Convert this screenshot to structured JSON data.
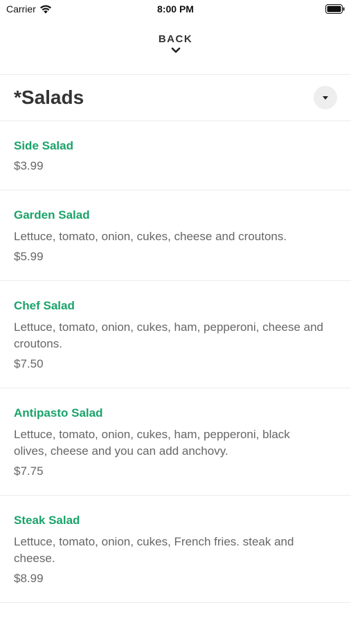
{
  "status_bar": {
    "carrier": "Carrier",
    "time": "8:00 PM"
  },
  "nav": {
    "back_label": "BACK"
  },
  "category": {
    "title": "*Salads"
  },
  "items": [
    {
      "name": "Side Salad",
      "description": "",
      "price": "$3.99"
    },
    {
      "name": "Garden Salad",
      "description": "Lettuce, tomato, onion, cukes, cheese and croutons.",
      "price": "$5.99"
    },
    {
      "name": "Chef Salad",
      "description": "Lettuce, tomato, onion, cukes, ham, pepperoni, cheese and croutons.",
      "price": "$7.50"
    },
    {
      "name": "Antipasto Salad",
      "description": "Lettuce, tomato, onion, cukes, ham, pepperoni, black olives, cheese and you can add anchovy.",
      "price": "$7.75"
    },
    {
      "name": "Steak Salad",
      "description": "Lettuce, tomato, onion, cukes, French fries. steak and cheese.",
      "price": "$8.99"
    }
  ],
  "colors": {
    "accent": "#1aa36a",
    "text": "#333333",
    "muted": "#666666"
  }
}
